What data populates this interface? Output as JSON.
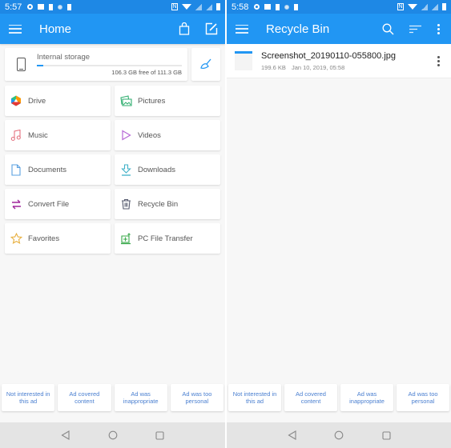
{
  "left": {
    "status": {
      "time": "5:57"
    },
    "appbar": {
      "title": "Home",
      "menu_icon": "hamburger-icon",
      "actions": [
        "shopping-bag-icon",
        "edit-icon"
      ]
    },
    "storage": {
      "label": "Internal storage",
      "free_text": "106.3 GB free of 111.3 GB",
      "used_fraction": 0.045,
      "clean_icon": "broom-icon"
    },
    "tiles": [
      {
        "label": "Drive",
        "icon": "drive-icon"
      },
      {
        "label": "Pictures",
        "icon": "pictures-icon"
      },
      {
        "label": "Music",
        "icon": "music-icon"
      },
      {
        "label": "Videos",
        "icon": "videos-icon"
      },
      {
        "label": "Documents",
        "icon": "documents-icon"
      },
      {
        "label": "Downloads",
        "icon": "downloads-icon"
      },
      {
        "label": "Convert File",
        "icon": "convert-icon"
      },
      {
        "label": "Recycle Bin",
        "icon": "trash-icon"
      },
      {
        "label": "Favorites",
        "icon": "star-icon"
      },
      {
        "label": "PC File Transfer",
        "icon": "pc-transfer-icon"
      }
    ],
    "ad_feedback": [
      "Not interested in this ad",
      "Ad covered content",
      "Ad was inappropriate",
      "Ad was too personal"
    ]
  },
  "right": {
    "status": {
      "time": "5:58"
    },
    "appbar": {
      "title": "Recycle Bin",
      "menu_icon": "hamburger-icon",
      "actions": [
        "search-icon",
        "sort-icon",
        "more-vert-icon"
      ]
    },
    "files": [
      {
        "name": "Screenshot_20190110-055800.jpg",
        "size": "199.6 KB",
        "date": "Jan 10, 2019, 05:58"
      }
    ],
    "ad_feedback": [
      "Not interested in this ad",
      "Ad covered content",
      "Ad was inappropriate",
      "Ad was too personal"
    ]
  },
  "colors": {
    "status_bar": "#1e88e5",
    "app_bar": "#2196f3",
    "ad_text": "#4a7fd0",
    "background": "#f7f7f7"
  }
}
